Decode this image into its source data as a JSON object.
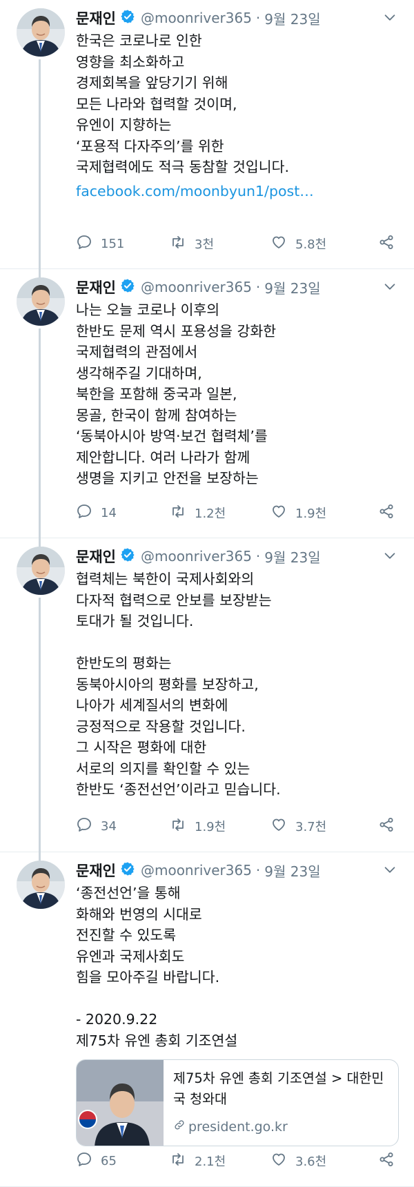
{
  "author": {
    "name": "문재인",
    "handle": "@moonriver365",
    "separator": "·",
    "date": "9월 23일"
  },
  "icons": {
    "avatar": "profile-photo",
    "verified": "verified-badge-icon",
    "caret": "chevron-down-icon",
    "reply": "reply-icon",
    "retweet": "retweet-icon",
    "like": "heart-icon",
    "share": "share-icon",
    "link": "link-icon"
  },
  "colors": {
    "verified_blue": "#1da1f2",
    "link_blue": "#1b95e0",
    "muted_gray": "#657786",
    "thread_line": "#ccd6dd"
  },
  "tweets": [
    {
      "body": "한국은 코로나로 인한\n영향을 최소화하고\n경제회복을 앞당기기 위해\n모든 나라와 협력할 것이며,\n유엔이 지향하는\n‘포용적 다자주의’를 위한\n국제협력에도 적극 동참할 것입니다.",
      "link": "facebook.com/moonbyun1/post…",
      "replies": "151",
      "retweets": "3천",
      "likes": "5.8천"
    },
    {
      "body": "나는 오늘 코로나 이후의\n한반도 문제 역시 포용성을 강화한\n국제협력의 관점에서\n생각해주길 기대하며,\n북한을 포함해 중국과 일본,\n몽골, 한국이 함께 참여하는\n‘동북아시아 방역·보건 협력체’를\n제안합니다. 여러 나라가 함께\n생명을 지키고 안전을 보장하는",
      "replies": "14",
      "retweets": "1.2천",
      "likes": "1.9천"
    },
    {
      "body": "협력체는 북한이 국제사회와의\n다자적 협력으로 안보를 보장받는\n토대가 될 것입니다.\n\n한반도의 평화는\n동북아시아의 평화를 보장하고,\n나아가 세계질서의 변화에\n긍정적으로 작용할 것입니다.\n그 시작은 평화에 대한\n서로의 의지를 확인할 수 있는\n한반도 ‘종전선언’이라고 믿습니다.",
      "replies": "34",
      "retweets": "1.9천",
      "likes": "3.7천"
    },
    {
      "body": "‘종전선언’을 통해\n화해와 번영의 시대로\n전진할 수 있도록\n유엔과 국제사회도\n힘을 모아주길 바랍니다.\n\n- 2020.9.22\n  제75차 유엔 총회 기조연설",
      "card": {
        "title": "제75차 유엔 총회 기조연설 > 대한민국 청와대",
        "url": "president.go.kr"
      },
      "replies": "65",
      "retweets": "2.1천",
      "likes": "3.6천"
    }
  ]
}
